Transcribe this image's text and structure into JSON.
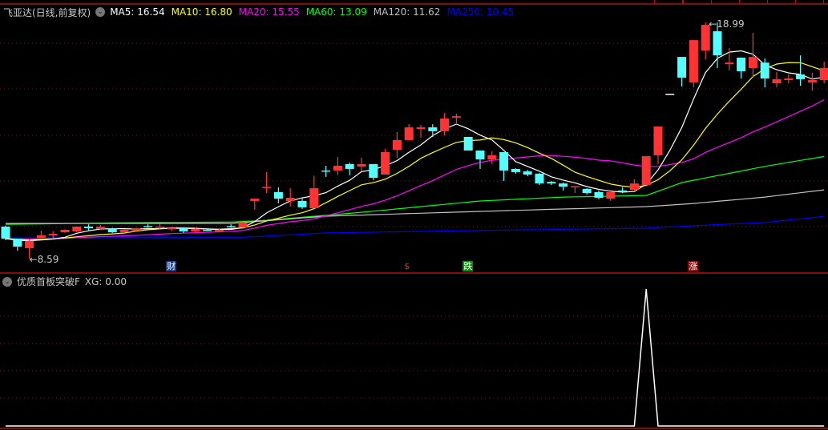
{
  "header": {
    "title": "飞亚达(日线,前复权)",
    "ma_labels": [
      {
        "text": "MA5: 16.54",
        "color": "#ffffff"
      },
      {
        "text": "MA10: 16.80",
        "color": "#ffff00"
      },
      {
        "text": "MA20: 15.55",
        "color": "#ff00ff"
      },
      {
        "text": "MA60: 13.09",
        "color": "#00ff00"
      },
      {
        "text": "MA120: 11.62",
        "color": "#c0c0c0"
      },
      {
        "text": "MA250: 10.45",
        "color": "#0000ff"
      }
    ]
  },
  "indicator": {
    "title": "优质首板突破F",
    "value_label": "XG: 0.00"
  },
  "annotations": {
    "high_label": "18.99",
    "low_label": "8.59"
  },
  "markers": [
    {
      "text": "财",
      "index": 14,
      "bg": "#1a3c8c",
      "fg": "#ffffff"
    },
    {
      "text": "$",
      "index": 34,
      "bg": "transparent",
      "fg": "#ff2020"
    },
    {
      "text": "跌",
      "index": 39,
      "bg": "#0a8a0a",
      "fg": "#ffffff"
    },
    {
      "text": "涨",
      "index": 58,
      "bg": "#8a0a0a",
      "fg": "#ffffff"
    }
  ],
  "colors": {
    "up": "#ff3333",
    "down": "#54ffff",
    "grid": "#7a1414",
    "border": "#b01010"
  },
  "chart_data": {
    "type": "candlestick",
    "price_range": [
      8.59,
      18.99
    ],
    "candles": [
      [
        10.0,
        9.47,
        10.05,
        9.4
      ],
      [
        9.47,
        9.12,
        9.47,
        8.94
      ],
      [
        9.05,
        9.37,
        9.44,
        8.59
      ],
      [
        9.51,
        9.62,
        9.82,
        9.5
      ],
      [
        9.61,
        9.68,
        9.8,
        9.5
      ],
      [
        9.75,
        9.86,
        9.88,
        9.73
      ],
      [
        9.79,
        10.0,
        10.02,
        9.75
      ],
      [
        10.0,
        9.93,
        10.1,
        9.8
      ],
      [
        9.9,
        10.0,
        10.07,
        9.88
      ],
      [
        9.93,
        9.75,
        9.95,
        9.72
      ],
      [
        9.75,
        9.86,
        9.88,
        9.72
      ],
      [
        9.82,
        9.93,
        9.95,
        9.8
      ],
      [
        10.02,
        10.0,
        10.1,
        9.95
      ],
      [
        10.0,
        10.0,
        10.12,
        9.9
      ],
      [
        9.88,
        9.95,
        10.0,
        9.8
      ],
      [
        9.93,
        9.79,
        9.98,
        9.72
      ],
      [
        9.79,
        9.9,
        9.95,
        9.7
      ],
      [
        9.86,
        9.84,
        9.92,
        9.8
      ],
      [
        9.79,
        9.86,
        9.9,
        9.76
      ],
      [
        10.02,
        10.0,
        10.1,
        9.95
      ],
      [
        9.97,
        10.18,
        10.2,
        9.9
      ],
      [
        11.13,
        11.23,
        11.23,
        10.74
      ],
      [
        11.7,
        11.75,
        12.4,
        11.48
      ],
      [
        11.52,
        11.23,
        11.73,
        11.03
      ],
      [
        11.13,
        11.27,
        11.69,
        10.88
      ],
      [
        11.13,
        10.85,
        11.23,
        10.78
      ],
      [
        10.81,
        11.69,
        12.24,
        10.81
      ],
      [
        12.47,
        12.43,
        12.68,
        12.19
      ],
      [
        12.47,
        12.68,
        13.07,
        12.26
      ],
      [
        12.75,
        12.54,
        12.82,
        12.26
      ],
      [
        12.64,
        12.75,
        13.03,
        12.43
      ],
      [
        12.75,
        12.15,
        12.75,
        12.05
      ],
      [
        12.29,
        13.28,
        13.42,
        12.29
      ],
      [
        13.38,
        13.81,
        14.16,
        13.03
      ],
      [
        13.81,
        14.37,
        14.51,
        13.81
      ],
      [
        14.3,
        14.37,
        14.48,
        13.91
      ],
      [
        14.37,
        14.2,
        14.51,
        13.95
      ],
      [
        14.2,
        14.76,
        15.0,
        14.02
      ],
      [
        14.8,
        14.86,
        14.97,
        14.51
      ],
      [
        13.95,
        13.35,
        13.95,
        13.35
      ],
      [
        13.35,
        12.96,
        13.35,
        12.54
      ],
      [
        12.96,
        13.14,
        13.32,
        12.75
      ],
      [
        13.28,
        12.47,
        13.28,
        12.01
      ],
      [
        12.54,
        12.4,
        12.57,
        12.33
      ],
      [
        12.43,
        12.29,
        12.5,
        12.22
      ],
      [
        12.33,
        11.9,
        12.36,
        11.83
      ],
      [
        11.97,
        11.9,
        12.01,
        11.83
      ],
      [
        11.9,
        11.76,
        11.94,
        11.59
      ],
      [
        11.76,
        11.78,
        11.78,
        11.48
      ],
      [
        11.66,
        11.48,
        11.69,
        11.41
      ],
      [
        11.52,
        11.27,
        11.59,
        11.2
      ],
      [
        11.23,
        11.52,
        11.62,
        11.13
      ],
      [
        11.59,
        11.55,
        11.73,
        11.48
      ],
      [
        11.62,
        11.9,
        12.08,
        11.55
      ],
      [
        11.83,
        13.1,
        13.1,
        11.83
      ],
      [
        13.14,
        14.41,
        14.41,
        12.75
      ],
      [
        15.85,
        15.85,
        15.85,
        15.85
      ],
      [
        17.47,
        16.56,
        17.47,
        16.17
      ],
      [
        16.35,
        18.21,
        18.21,
        16.13
      ],
      [
        17.75,
        18.88,
        18.99,
        17.36
      ],
      [
        18.6,
        17.54,
        18.99,
        16.98
      ],
      [
        17.15,
        17.22,
        17.86,
        16.87
      ],
      [
        17.44,
        16.84,
        17.44,
        16.52
      ],
      [
        16.98,
        17.47,
        18.53,
        16.59
      ],
      [
        17.22,
        16.52,
        17.4,
        16.13
      ],
      [
        16.31,
        16.49,
        16.8,
        16.13
      ],
      [
        16.45,
        16.52,
        16.7,
        16.3
      ],
      [
        16.7,
        16.49,
        17.54,
        16.2
      ],
      [
        16.35,
        16.45,
        16.77,
        15.99
      ],
      [
        16.45,
        16.98,
        17.26,
        16.31
      ]
    ],
    "candle_format": [
      "open",
      "close",
      "high",
      "low"
    ],
    "ma_computed": [
      {
        "name": "MA5",
        "period": 5,
        "color": "#ffffff"
      },
      {
        "name": "MA10",
        "period": 10,
        "color": "#ffff00"
      },
      {
        "name": "MA20",
        "period": 20,
        "color": "#ff00ff"
      }
    ],
    "ma_keyframes": [
      {
        "name": "MA60",
        "color": "#00ff00",
        "points": [
          [
            0,
            10.1
          ],
          [
            10,
            10.17
          ],
          [
            19,
            10.2
          ],
          [
            22,
            10.28
          ],
          [
            30,
            10.63
          ],
          [
            40,
            11.13
          ],
          [
            47,
            11.3
          ],
          [
            54,
            11.37
          ],
          [
            57,
            11.94
          ],
          [
            64,
            12.65
          ],
          [
            69,
            13.09
          ]
        ]
      },
      {
        "name": "MA120",
        "color": "#c0c0c0",
        "points": [
          [
            0,
            10.14
          ],
          [
            19,
            10.14
          ],
          [
            27,
            10.46
          ],
          [
            40,
            10.67
          ],
          [
            54,
            10.88
          ],
          [
            58,
            11.02
          ],
          [
            64,
            11.3
          ],
          [
            69,
            11.62
          ]
        ]
      },
      {
        "name": "MA250",
        "color": "#0000ff",
        "points": [
          [
            0,
            9.5
          ],
          [
            20,
            9.53
          ],
          [
            27,
            9.72
          ],
          [
            40,
            9.83
          ],
          [
            54,
            9.93
          ],
          [
            58,
            10.04
          ],
          [
            64,
            10.18
          ],
          [
            69,
            10.45
          ]
        ]
      }
    ],
    "xg_signal": {
      "name": "XG",
      "range": [
        0,
        1
      ],
      "values_nonzero": [
        [
          54,
          1
        ]
      ]
    }
  }
}
